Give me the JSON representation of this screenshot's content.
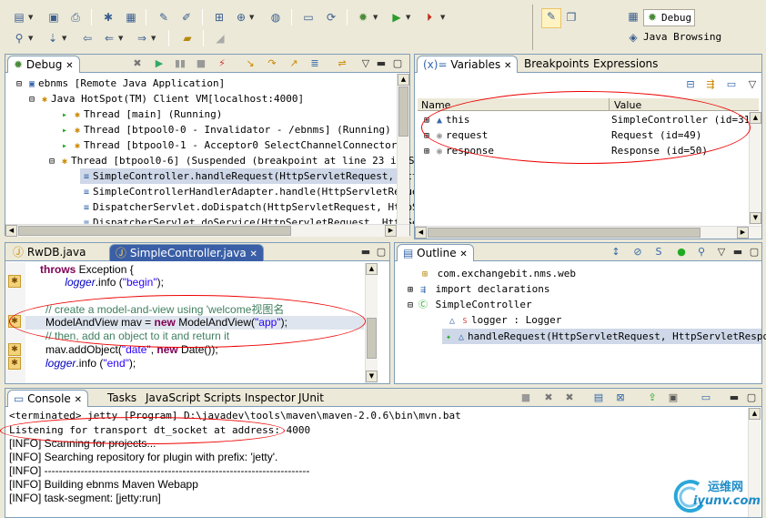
{
  "perspectives": {
    "debug": "Debug",
    "java_browsing": "Java Browsing"
  },
  "debug_view": {
    "tab": "Debug",
    "rows": [
      "ebnms [Remote Java Application]",
      "Java HotSpot(TM) Client VM[localhost:4000]",
      "Thread [main] (Running)",
      "Thread [btpool0-0 - Invalidator - /ebnms] (Running)",
      "Thread [btpool0-1 - Acceptor0 SelectChannelConnector @ 0.0",
      "Thread [btpool0-6] (Suspended (breakpoint at line 23 in Si",
      "SimpleController.handleRequest(HttpServletRequest, Http",
      "SimpleControllerHandlerAdapter.handle(HttpServletReques",
      "DispatcherServlet.doDispatch(HttpServletRequest, HttpSe",
      "DispatcherServlet.doService(HttpServletRequest, HttpSe"
    ]
  },
  "variables_view": {
    "tabs": [
      "Variables",
      "Breakpoints",
      "Expressions"
    ],
    "columns": [
      "Name",
      "Value"
    ],
    "rows": [
      {
        "name": "this",
        "value": "SimpleController  (id=31)"
      },
      {
        "name": "request",
        "value": "Request  (id=49)"
      },
      {
        "name": "response",
        "value": "Response  (id=50)"
      }
    ]
  },
  "editor": {
    "tabs": [
      "RwDB.java",
      "SimpleController.java"
    ],
    "lines": [
      {
        "parts": [
          [
            "kw",
            "throws"
          ],
          [
            "",
            " Exception {"
          ]
        ]
      },
      {
        "parts": [
          [
            "",
            "    "
          ],
          [
            "it",
            "logger"
          ],
          [
            "",
            ".info ("
          ],
          [
            "str",
            "\"begin\""
          ],
          [
            "",
            ");"
          ]
        ]
      },
      {
        "parts": [
          [
            "",
            ""
          ]
        ]
      },
      {
        "parts": [
          [
            "cm",
            "// create a model-and-view using 'welcome视图名"
          ]
        ]
      },
      {
        "parts": [
          [
            "",
            "ModelAndView mav = "
          ],
          [
            "kw",
            "new"
          ],
          [
            "",
            " ModelAndView("
          ],
          [
            "str",
            "\"app\""
          ],
          [
            "",
            ");"
          ]
        ]
      },
      {
        "parts": [
          [
            "cm",
            "// then, add an object to it and return it"
          ]
        ]
      },
      {
        "parts": [
          [
            "",
            "mav.addObject("
          ],
          [
            "str",
            "\"date\""
          ],
          [
            "",
            ", "
          ],
          [
            "kw",
            "new"
          ],
          [
            "",
            " Date());"
          ]
        ]
      },
      {
        "parts": [
          [
            "it",
            "logger"
          ],
          [
            "",
            ".info ("
          ],
          [
            "str",
            "\"end\""
          ],
          [
            "",
            ");"
          ]
        ]
      }
    ]
  },
  "outline_view": {
    "tab": "Outline",
    "rows": [
      "com.exchangebit.nms.web",
      "import declarations",
      "SimpleController",
      "logger : Logger",
      "handleRequest(HttpServletRequest, HttpServletResponse)"
    ]
  },
  "console_view": {
    "tabs": [
      "Console",
      "Tasks",
      "JavaScript Scripts Inspector",
      "JUnit"
    ],
    "header": "<terminated> jetty [Program] D:\\javadev\\tools\\maven\\maven-2.0.6\\bin\\mvn.bat",
    "lines": [
      "Listening for transport dt_socket at address: 4000",
      "[INFO] Scanning for projects...",
      "[INFO] Searching repository for plugin with prefix: 'jetty'.",
      "[INFO] -------------------------------------------------------------------------",
      "[INFO] Building ebnms Maven Webapp",
      "[INFO]    task-segment: [jetty:run]"
    ]
  },
  "watermark": {
    "text1": "运维网",
    "text2": "iyunv.com"
  },
  "colors": {
    "accent": "#7f9db9",
    "selection": "#cfd8e8",
    "annotation": "#e00000",
    "keyword": "#7f0055",
    "string": "#2a00ff",
    "comment": "#3f7f5f"
  }
}
